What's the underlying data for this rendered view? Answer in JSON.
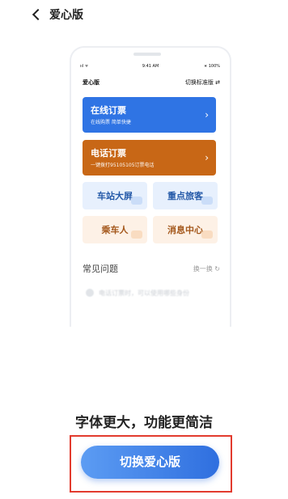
{
  "header": {
    "back_icon": "chevron-left-icon",
    "title": "爱心版"
  },
  "preview": {
    "status_left": "ııl ᯤ",
    "status_time": "9:41 AM",
    "status_right": "∗ 100%",
    "page_title": "爱心版",
    "switch_label": "切换标准版 ⇄",
    "cards": [
      {
        "title": "在线订票",
        "subtitle": "在线购票  简单快捷",
        "arrow": "›",
        "color": "#2f74e4"
      },
      {
        "title": "电话订票",
        "subtitle": "一键拨打95105105订票电话",
        "arrow": "›",
        "color": "#c86716"
      }
    ],
    "tiles": [
      "车站大屏",
      "重点旅客",
      "乘车人",
      "消息中心"
    ],
    "faq": {
      "title": "常见问题",
      "refresh_label": "换一换 ↻",
      "item": "电话订票时，可以使用哪些身份"
    }
  },
  "slogan": "字体更大，功能更简洁",
  "primary_button": {
    "label": "切换爱心版",
    "highlight_color": "#e23b2e"
  }
}
